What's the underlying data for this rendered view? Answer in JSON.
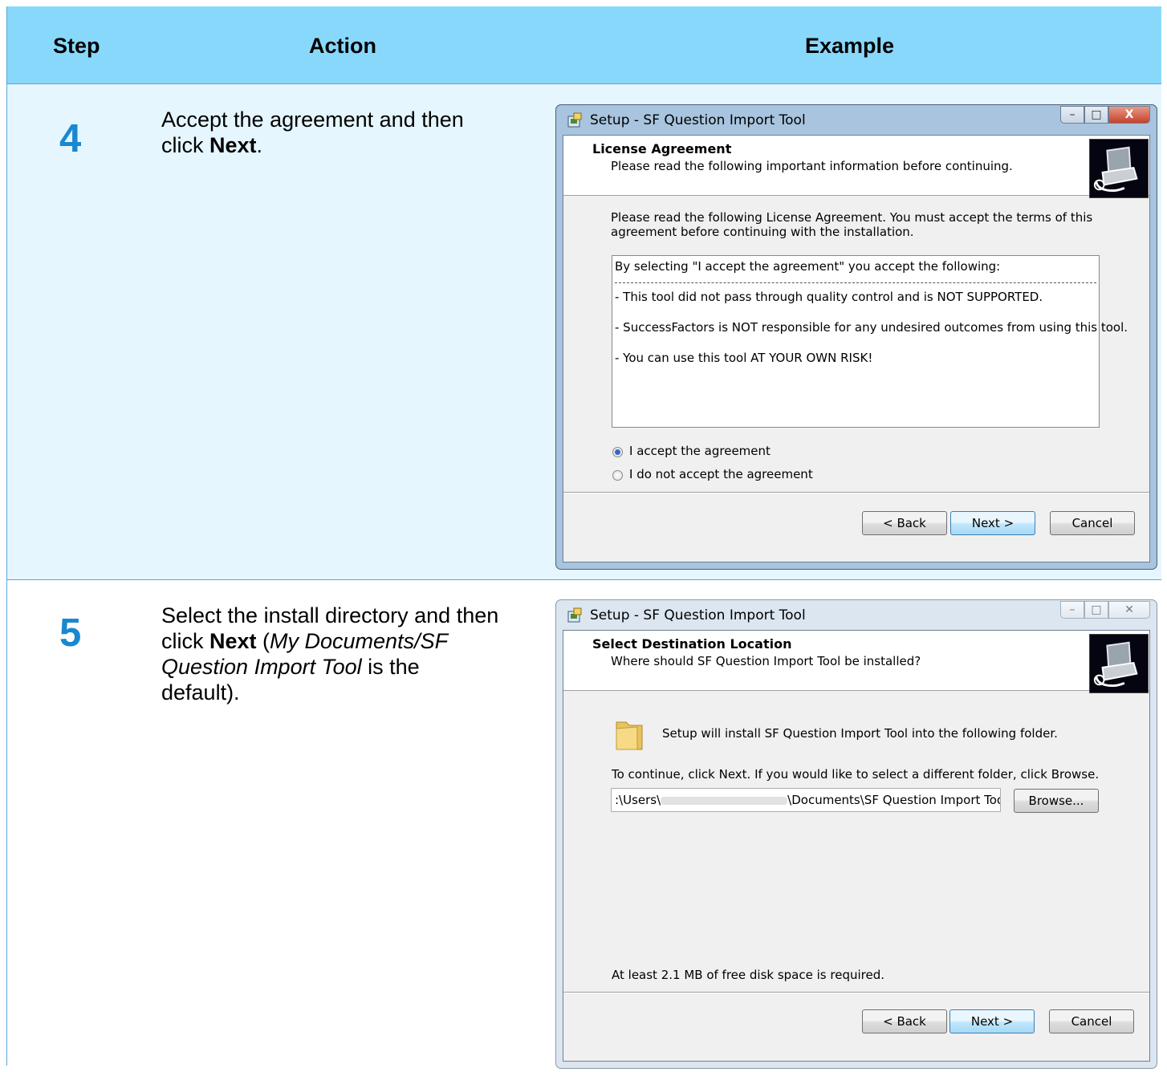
{
  "header": {
    "step": "Step",
    "action": "Action",
    "example": "Example"
  },
  "rows": [
    {
      "step": "4",
      "action": {
        "line1": "Accept the agreement and then",
        "line2_pre": "click ",
        "line2_bold": "Next",
        "line2_post": "."
      },
      "dialog": {
        "title": "Setup - SF Question Import Tool",
        "heading": "License Agreement",
        "subheading": "Please read the following important information before continuing.",
        "intro_line1": "Please read the following License Agreement. You must accept the terms of this",
        "intro_line2": "agreement before continuing with the installation.",
        "license_lines": [
          "By selecting \"I accept the agreement\" you accept the following:",
          "- This tool did not pass through quality control and is NOT SUPPORTED.",
          "- SuccessFactors is NOT responsible for any undesired outcomes from using this tool.",
          "- You can use this tool AT YOUR OWN RISK!"
        ],
        "radio_accept": "I accept the agreement",
        "radio_decline": "I do not accept the agreement",
        "selected_radio": "accept",
        "back": "< Back",
        "next": "Next >",
        "cancel": "Cancel"
      }
    },
    {
      "step": "5",
      "action": {
        "line1": "Select the install directory and then",
        "line2_pre": "click ",
        "line2_bold": "Next",
        "line2_mid": " (",
        "line2_italic": "My Documents/SF",
        "line3_italic": "Question Import Tool",
        "line3_post": " is the",
        "line4": "default)."
      },
      "dialog": {
        "title": "Setup - SF Question Import Tool",
        "heading": "Select Destination Location",
        "subheading": "Where should SF Question Import Tool be installed?",
        "folder_text": "Setup will install SF Question Import Tool into the following folder.",
        "continue_text": "To continue, click Next. If you would like to select a different folder, click Browse.",
        "path_prefix": ":\\Users\\",
        "path_suffix": "\\Documents\\SF Question Import Tool",
        "browse": "Browse...",
        "disk_space": "At least 2.1 MB of free disk space is required.",
        "back": "< Back",
        "next": "Next >",
        "cancel": "Cancel"
      }
    }
  ],
  "colors": {
    "header_bg": "#88d8fc",
    "row_bg": "#e5f6fe",
    "step_number": "#1a88d0",
    "border": "#5aa6d8"
  }
}
